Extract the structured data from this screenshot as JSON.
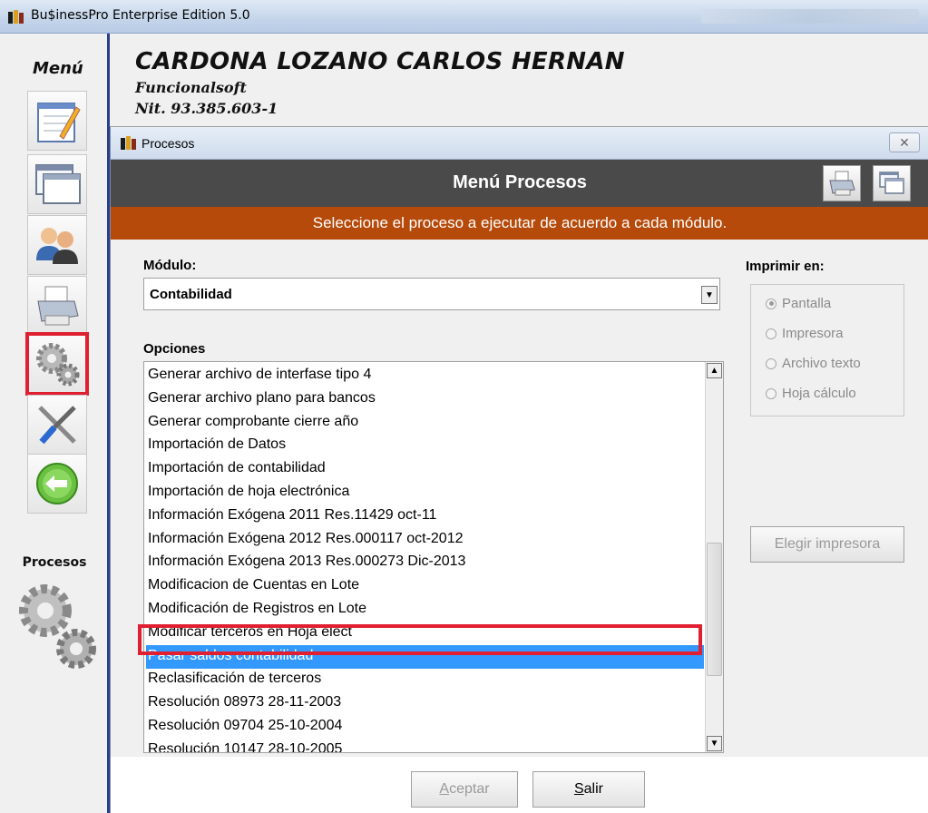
{
  "app": {
    "title": "Bu$inessPro Enterprise Edition 5.0"
  },
  "sidebar": {
    "menu_label": "Menú",
    "items": [
      {
        "name": "notepad-icon"
      },
      {
        "name": "window-icon"
      },
      {
        "name": "users-icon"
      },
      {
        "name": "printer-icon"
      },
      {
        "name": "gears-icon",
        "active": true
      },
      {
        "name": "tools-icon"
      },
      {
        "name": "back-arrow-icon"
      }
    ],
    "section_label": "Procesos"
  },
  "company": {
    "name": "CARDONA LOZANO CARLOS HERNAN",
    "subtitle": "Funcionalsoft",
    "nit": "Nit. 93.385.603-1"
  },
  "window": {
    "title": "Procesos",
    "close_glyph": "✕"
  },
  "menu": {
    "title": "Menú Procesos",
    "instruction": "Seleccione el proceso a ejecutar de acuerdo a cada módulo."
  },
  "form": {
    "modulo_label": "Módulo:",
    "modulo_value": "Contabilidad",
    "opciones_label": "Opciones",
    "options": [
      "Generar archivo de interfase tipo 4",
      "Generar archivo plano para bancos",
      "Generar comprobante cierre año",
      "Importación de Datos",
      "Importación de contabilidad",
      "Importación de hoja electrónica",
      "Información Exógena 2011 Res.11429 oct-11",
      "Información Exógena 2012 Res.000117 oct-2012",
      "Información Exógena 2013 Res.000273 Dic-2013",
      "Modificacion de Cuentas en Lote",
      "Modificación de Registros en Lote",
      "Modificar terceros en Hoja elect",
      "Pasar saldos contabilidad",
      "Reclasificación de terceros",
      "Resolución 08973 28-11-2003",
      "Resolución 09704 25-10-2004",
      "Resolución 10147 28-10-2005"
    ],
    "selected_option": "Pasar saldos contabilidad"
  },
  "print": {
    "label": "Imprimir en:",
    "options": [
      "Pantalla",
      "Impresora",
      "Archivo texto",
      "Hoja cálculo"
    ],
    "selected": "Pantalla",
    "elegir_label": "Elegir impresora"
  },
  "buttons": {
    "aceptar_first": "A",
    "aceptar_rest": "ceptar",
    "salir_first": "S",
    "salir_rest": "alir"
  },
  "colors": {
    "header_bg": "#4a4a4a",
    "subheader_bg": "#b54a0a",
    "selection": "#3399ff",
    "highlight_outline": "#e02030"
  }
}
